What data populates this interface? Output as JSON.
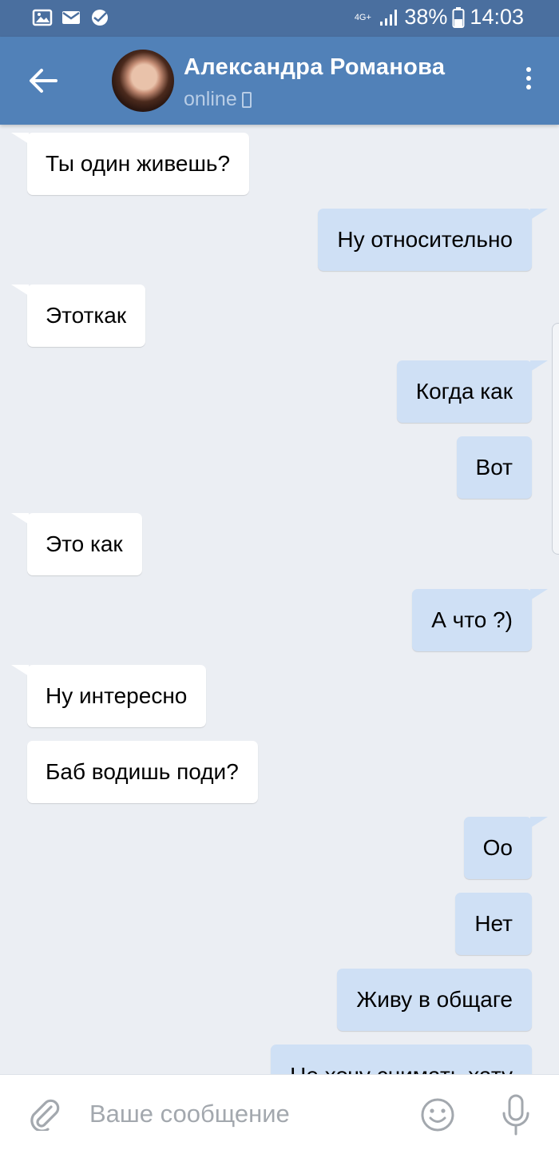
{
  "status_bar": {
    "network": "4G+",
    "battery": "38%",
    "time": "14:03",
    "icons": [
      "image-icon",
      "mail-icon",
      "sberbank-icon",
      "signal-icon",
      "battery-icon"
    ]
  },
  "header": {
    "name": "Александра Романова",
    "status": "online",
    "back_icon": "arrow-back-icon",
    "menu_icon": "more-vertical-icon"
  },
  "messages": [
    {
      "side": "in",
      "text": "Ты один живешь?"
    },
    {
      "side": "out",
      "text": "Ну относительно"
    },
    {
      "side": "in",
      "text": "Этоткак"
    },
    {
      "side": "out",
      "text": "Когда как"
    },
    {
      "side": "out",
      "text": "Вот"
    },
    {
      "side": "in",
      "text": "Это как"
    },
    {
      "side": "out",
      "text": "А что ?)"
    },
    {
      "side": "in",
      "text": "Ну интересно"
    },
    {
      "side": "in",
      "text": "Баб водишь поди?"
    },
    {
      "side": "out",
      "text": "Оо"
    },
    {
      "side": "out",
      "text": "Нет"
    },
    {
      "side": "out",
      "text": "Живу в общаге"
    },
    {
      "side": "out",
      "text": "Не хочу снимать хату"
    }
  ],
  "input": {
    "placeholder": "Ваше сообщение",
    "value": ""
  },
  "colors": {
    "status_bar": "#4a6f9f",
    "header": "#5181b8",
    "background": "#ebeef3",
    "incoming_bubble": "#ffffff",
    "outgoing_bubble": "#cfe0f5"
  }
}
